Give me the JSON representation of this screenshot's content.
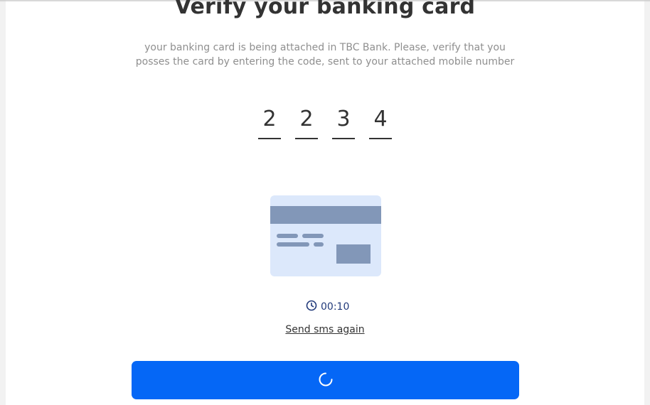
{
  "title": "Verify your banking card",
  "subtitle": "your banking card is being attached in TBC Bank. Please, verify that you posses the card by entering the code, sent to your attached mobile number",
  "code_digits": [
    "2",
    "2",
    "3",
    "4"
  ],
  "timer": {
    "value": "00:10",
    "icon": "clock-icon"
  },
  "resend_label": "Send sms again",
  "submit_button": {
    "icon": "loading-spinner-icon",
    "state": "loading"
  },
  "colors": {
    "primary": "#0567f6",
    "card_background": "#dce8fb",
    "card_accent": "#8297b8",
    "timer_text": "#223a7a"
  }
}
